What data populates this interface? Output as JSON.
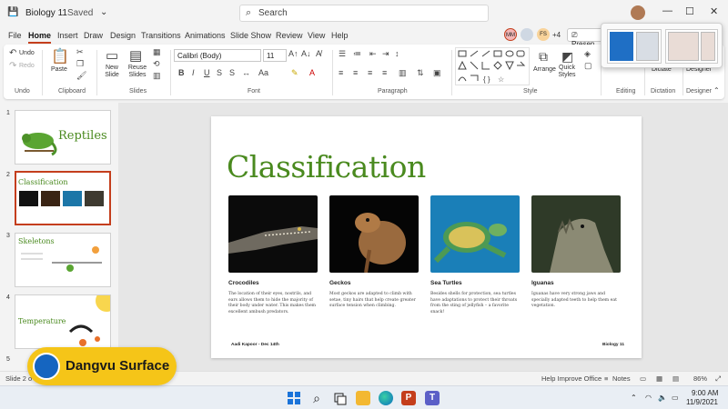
{
  "titlebar": {
    "app_title": "Biology 11",
    "saved": "Saved",
    "search_placeholder": "Search"
  },
  "tabs": [
    "File",
    "Home",
    "Insert",
    "Draw",
    "Design",
    "Transitions",
    "Animations",
    "Slide Show",
    "Review",
    "View",
    "Help"
  ],
  "collaborators": {
    "count": "+4",
    "initials1": "MM",
    "initials2": "FS"
  },
  "present_label": "Presen",
  "ribbon": {
    "undo": "Undo",
    "redo": "Redo",
    "paste": "Paste",
    "new_slide": "New Slide",
    "reuse_slides": "Reuse Slides",
    "font_name": "Calibri (Body)",
    "font_size": "11",
    "arrange": "Arrange",
    "quick_styles": "Quick Styles",
    "dictate": "Dictate",
    "designer": "Designer",
    "groups": {
      "undo": "Undo",
      "clipboard": "Clipboard",
      "slides": "Slides",
      "font": "Font",
      "paragraph": "Paragraph",
      "style": "Style",
      "editing": "Editing",
      "dictation": "Dictation",
      "designer": "Designer"
    }
  },
  "thumbnails": [
    {
      "num": "1",
      "title": "Reptiles"
    },
    {
      "num": "2",
      "title": "Classification"
    },
    {
      "num": "3",
      "title": "Skeletons"
    },
    {
      "num": "4",
      "title": "Temperature"
    },
    {
      "num": "5",
      "title": ""
    }
  ],
  "slide": {
    "title": "Classification",
    "cards": [
      {
        "title": "Crocodiles",
        "desc": "The location of their eyes, nostrils, and ears allows them to hide the majority of their body under water. This makes them excellent ambush predators."
      },
      {
        "title": "Geckos",
        "desc": "Most geckos are adapted to climb with setae, tiny hairs that help create greater surface tension when climbing."
      },
      {
        "title": "Sea Turtles",
        "desc": "Besides shells for protection, sea turtles have adaptations to protect their throats from the sting of jellyfish – a favorite snack!"
      },
      {
        "title": "Iguanas",
        "desc": "Iguanas have very strong jaws and specially adapted teeth to help them eat vegetation."
      }
    ],
    "footer_left": "Aadi Kapoor - Dec 14th",
    "footer_right": "Biology 11"
  },
  "statusbar": {
    "slide_info": "Slide 2 o",
    "help_improve": "Help Improve Office",
    "notes": "Notes",
    "zoom": "86%"
  },
  "taskbar": {
    "time": "9:00 AM",
    "date": "11/9/2021"
  },
  "watermark": {
    "brand": "Dangvu Surface"
  },
  "colors": {
    "accent": "#c43e1c",
    "title_green": "#4a8a1f"
  }
}
